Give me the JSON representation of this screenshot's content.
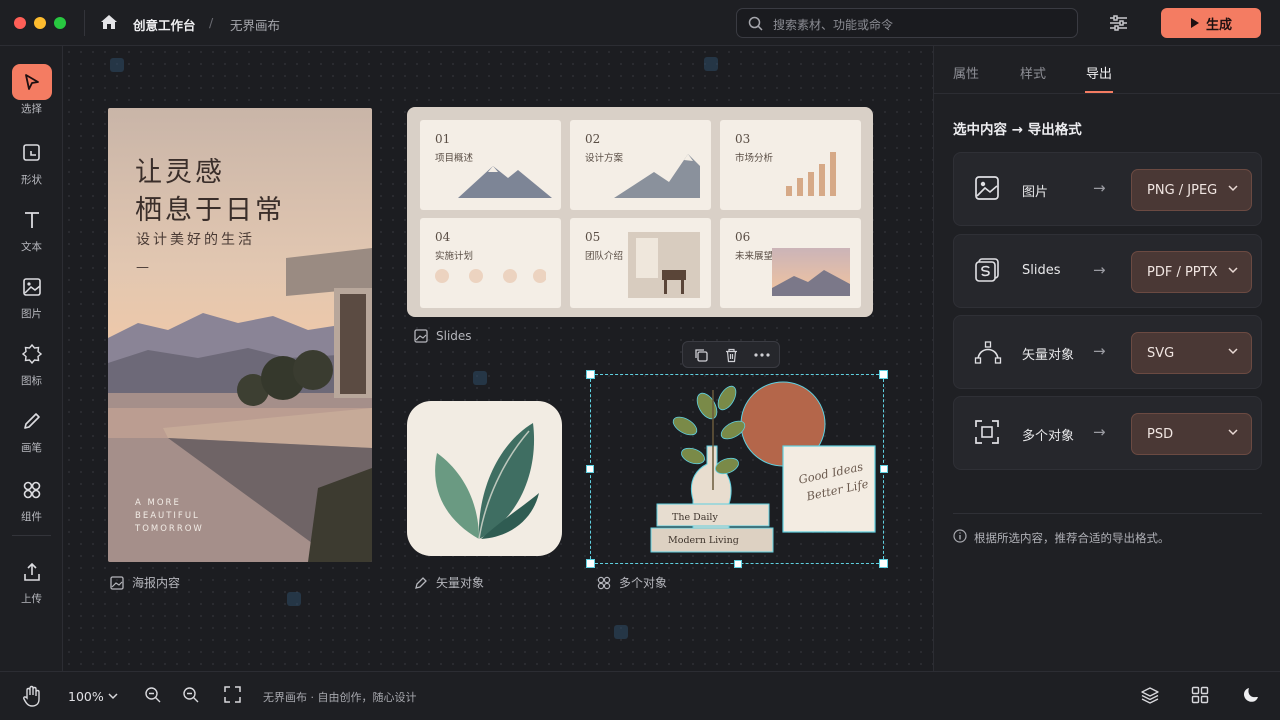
{
  "topbar": {
    "home_label": "创意工作台",
    "separator": "/",
    "page_label": "无界画布",
    "search_placeholder": "搜索素材、功能或命令",
    "generate_label": "生成"
  },
  "tools": [
    {
      "label": "选择",
      "icon": "cursor-icon"
    },
    {
      "label": "形状",
      "icon": "shape-icon"
    },
    {
      "label": "文本",
      "icon": "text-icon"
    },
    {
      "label": "图片",
      "icon": "image-icon"
    },
    {
      "label": "图标",
      "icon": "badge-icon"
    },
    {
      "label": "画笔",
      "icon": "pen-icon"
    },
    {
      "label": "组件",
      "icon": "components-icon"
    },
    {
      "label": "上传",
      "icon": "upload-icon"
    }
  ],
  "poster": {
    "title_line1": "让灵感",
    "title_line2": "栖息于日常",
    "subtitle": "设计美好的生活",
    "dash": "—",
    "footer_line1": "A MORE",
    "footer_line2": "BEAUTIFUL",
    "footer_line3": "TOMORROW",
    "caption": "海报内容"
  },
  "slides": {
    "caption": "Slides",
    "cards": [
      {
        "num": "01",
        "title": "项目概述"
      },
      {
        "num": "02",
        "title": "设计方案"
      },
      {
        "num": "03",
        "title": "市场分析"
      },
      {
        "num": "04",
        "title": "实施计划"
      },
      {
        "num": "05",
        "title": "团队介绍"
      },
      {
        "num": "06",
        "title": "未来展望"
      }
    ]
  },
  "vector": {
    "caption": "矢量对象"
  },
  "multi": {
    "caption": "多个对象",
    "book1": "The Daily",
    "book2": "Modern Living",
    "card_line1": "Good Ideas",
    "card_line2": "Better Life"
  },
  "panel": {
    "tabs": [
      "属性",
      "样式",
      "导出"
    ],
    "active_tab": "导出",
    "heading": "选中内容 → 导出格式",
    "rows": [
      {
        "name": "图片",
        "arrow": "→",
        "format": "PNG / JPEG"
      },
      {
        "name": "Slides",
        "arrow": "→",
        "format": "PDF / PPTX"
      },
      {
        "name": "矢量对象",
        "arrow": "→",
        "format": "SVG"
      },
      {
        "name": "多个对象",
        "arrow": "→",
        "format": "PSD"
      }
    ],
    "hint": "根据所选内容，推荐合适的导出格式。"
  },
  "bottombar": {
    "zoom": "100%",
    "status": "无界画布 · 自由创作，随心设计"
  },
  "colors": {
    "accent": "#f47c62",
    "selection": "#5fd0e0",
    "dropdown": "#4a3835"
  }
}
